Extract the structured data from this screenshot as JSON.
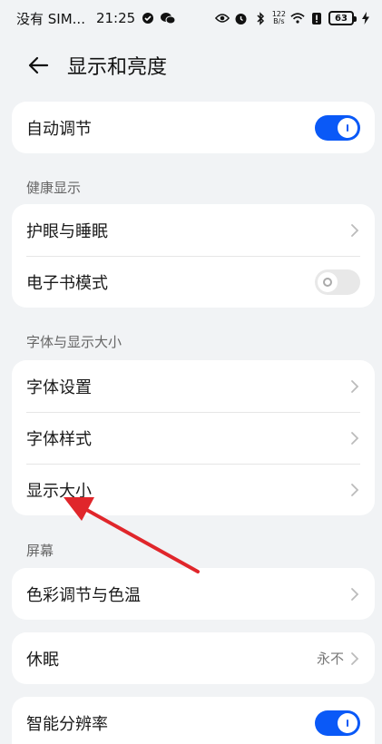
{
  "status_bar": {
    "carrier": "没有 SIM...",
    "time": "21:25",
    "speed_top": "122",
    "speed_bottom": "B/s",
    "battery": "63"
  },
  "header": {
    "title": "显示和亮度"
  },
  "sections": {
    "auto": {
      "label": "自动调节",
      "toggle": "on"
    },
    "health": {
      "title": "健康显示",
      "items": [
        {
          "label": "护眼与睡眠"
        },
        {
          "label": "电子书模式",
          "toggle": "off"
        }
      ]
    },
    "font": {
      "title": "字体与显示大小",
      "items": [
        {
          "label": "字体设置"
        },
        {
          "label": "字体样式"
        },
        {
          "label": "显示大小"
        }
      ]
    },
    "screen": {
      "title": "屏幕",
      "items": [
        {
          "label": "色彩调节与色温"
        }
      ]
    },
    "sleep": {
      "label": "休眠",
      "value": "永不"
    },
    "resolution": {
      "label": "智能分辨率",
      "toggle": "on"
    }
  },
  "colors": {
    "accent": "#0a59f7",
    "annotation": "#e0262b",
    "background": "#f1f3f5"
  },
  "icons": [
    "back-arrow-icon",
    "chevron-right-icon",
    "eye-icon",
    "alarm-icon",
    "bluetooth-icon",
    "wifi-icon",
    "battery-icon",
    "charging-icon"
  ]
}
